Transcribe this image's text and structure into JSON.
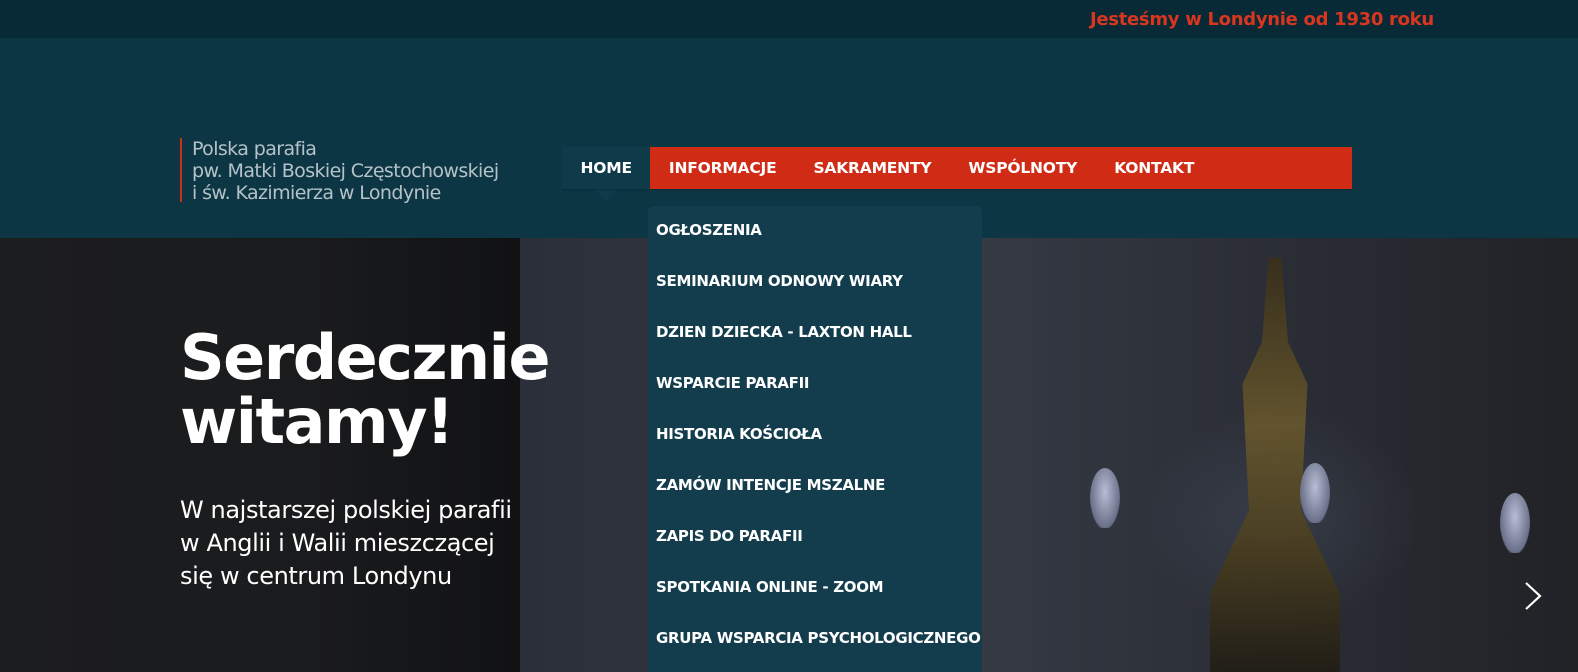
{
  "topbar": {
    "tagline": "Jesteśmy w Londynie od 1930 roku"
  },
  "logo": {
    "lines": [
      "Polska parafia",
      "pw. Matki Boskiej Częstochowskiej",
      "i św. Kazimierza w Londynie"
    ]
  },
  "nav": {
    "items": [
      {
        "label": "HOME",
        "active": true
      },
      {
        "label": "INFORMACJE"
      },
      {
        "label": "SAKRAMENTY"
      },
      {
        "label": "WSPÓLNOTY"
      },
      {
        "label": "KONTAKT"
      }
    ]
  },
  "dropdown": {
    "items": [
      "OGŁOSZENIA",
      "SEMINARIUM ODNOWY WIARY",
      "DZIEN DZIECKA - LAXTON HALL",
      "WSPARCIE PARAFII",
      "HISTORIA KOŚCIOŁA",
      "ZAMÓW INTENCJE MSZALNE",
      "ZAPIS DO PARAFII",
      "SPOTKANIA ONLINE - ZOOM",
      "GRUPA WSPARCIA PSYCHOLOGICZNEGO"
    ]
  },
  "hero": {
    "title_lines": [
      "Serdecznie",
      "witamy!"
    ],
    "subtitle_lines": [
      "W najstarszej polskiej parafii",
      "w Anglii i Walii mieszczącej",
      "się w centrum Londynu"
    ]
  },
  "colors": {
    "accent": "#cf2b15",
    "header_bg": "#0d3645",
    "topbar_bg": "#082a36",
    "dropdown_bg": "#133d4d"
  },
  "icons": {
    "next": "chevron-right-icon"
  }
}
